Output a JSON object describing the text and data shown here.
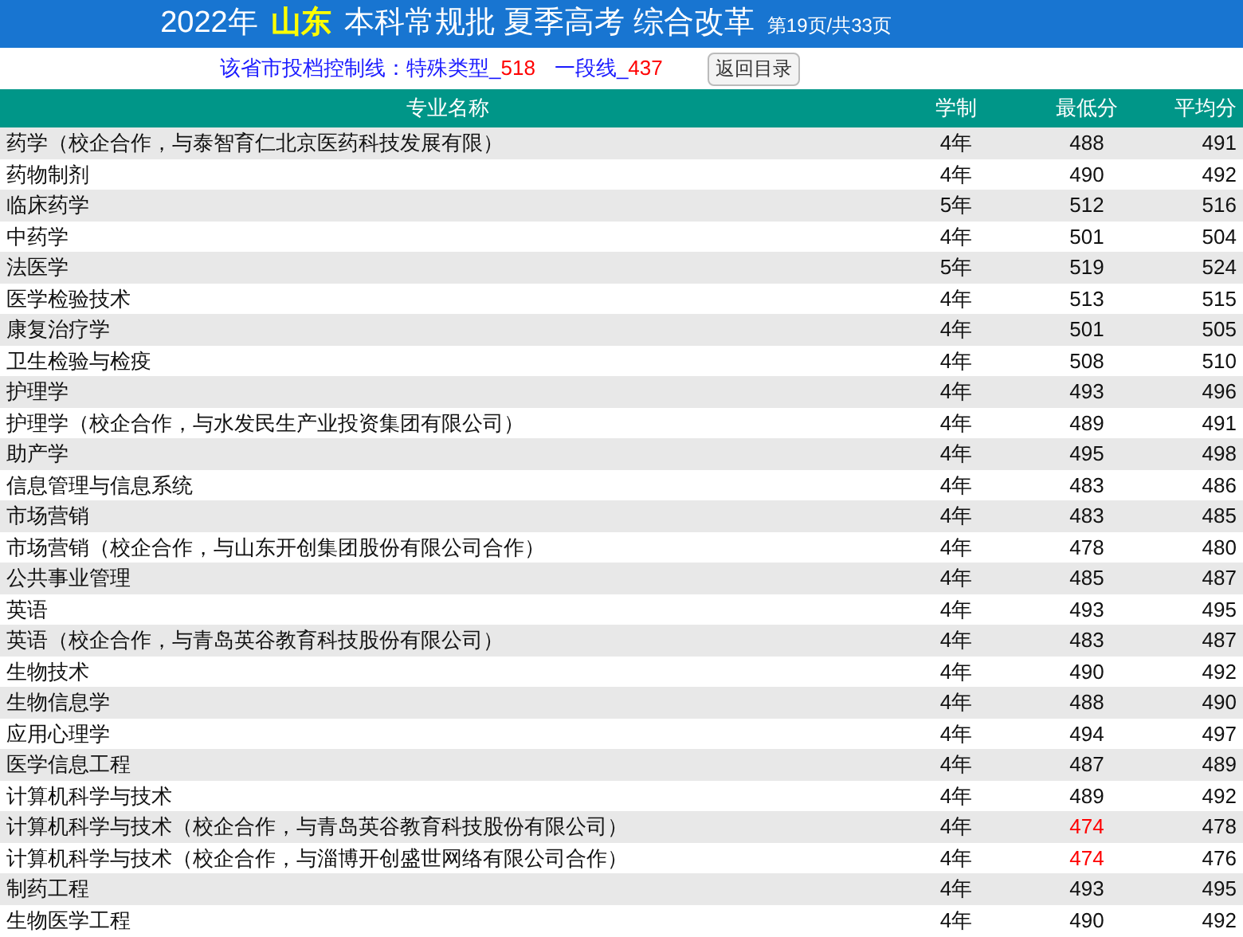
{
  "header": {
    "year": "2022年",
    "province": "山东",
    "title": "本科常规批 夏季高考 综合改革",
    "page": "第19页/共33页"
  },
  "control_line": {
    "label": "该省市投档控制线：特殊类型_",
    "special": "518",
    "first_label": "一段线_",
    "first": "437"
  },
  "back_button": "返回目录",
  "table": {
    "columns": [
      "专业名称",
      "学制",
      "最低分",
      "平均分"
    ],
    "rows": [
      {
        "name": "药学（校企合作，与泰智育仁北京医药科技发展有限）",
        "years": "4年",
        "min": "488",
        "avg": "491",
        "highlight": false
      },
      {
        "name": "药物制剂",
        "years": "4年",
        "min": "490",
        "avg": "492",
        "highlight": false
      },
      {
        "name": "临床药学",
        "years": "5年",
        "min": "512",
        "avg": "516",
        "highlight": false
      },
      {
        "name": "中药学",
        "years": "4年",
        "min": "501",
        "avg": "504",
        "highlight": false
      },
      {
        "name": "法医学",
        "years": "5年",
        "min": "519",
        "avg": "524",
        "highlight": false
      },
      {
        "name": "医学检验技术",
        "years": "4年",
        "min": "513",
        "avg": "515",
        "highlight": false
      },
      {
        "name": "康复治疗学",
        "years": "4年",
        "min": "501",
        "avg": "505",
        "highlight": false
      },
      {
        "name": "卫生检验与检疫",
        "years": "4年",
        "min": "508",
        "avg": "510",
        "highlight": false
      },
      {
        "name": "护理学",
        "years": "4年",
        "min": "493",
        "avg": "496",
        "highlight": false
      },
      {
        "name": "护理学（校企合作，与水发民生产业投资集团有限公司）",
        "years": "4年",
        "min": "489",
        "avg": "491",
        "highlight": false
      },
      {
        "name": "助产学",
        "years": "4年",
        "min": "495",
        "avg": "498",
        "highlight": false
      },
      {
        "name": "信息管理与信息系统",
        "years": "4年",
        "min": "483",
        "avg": "486",
        "highlight": false
      },
      {
        "name": "市场营销",
        "years": "4年",
        "min": "483",
        "avg": "485",
        "highlight": false
      },
      {
        "name": "市场营销（校企合作，与山东开创集团股份有限公司合作）",
        "years": "4年",
        "min": "478",
        "avg": "480",
        "highlight": false
      },
      {
        "name": "公共事业管理",
        "years": "4年",
        "min": "485",
        "avg": "487",
        "highlight": false
      },
      {
        "name": "英语",
        "years": "4年",
        "min": "493",
        "avg": "495",
        "highlight": false
      },
      {
        "name": "英语（校企合作，与青岛英谷教育科技股份有限公司）",
        "years": "4年",
        "min": "483",
        "avg": "487",
        "highlight": false
      },
      {
        "name": "生物技术",
        "years": "4年",
        "min": "490",
        "avg": "492",
        "highlight": false
      },
      {
        "name": "生物信息学",
        "years": "4年",
        "min": "488",
        "avg": "490",
        "highlight": false
      },
      {
        "name": "应用心理学",
        "years": "4年",
        "min": "494",
        "avg": "497",
        "highlight": false
      },
      {
        "name": "医学信息工程",
        "years": "4年",
        "min": "487",
        "avg": "489",
        "highlight": false
      },
      {
        "name": "计算机科学与技术",
        "years": "4年",
        "min": "489",
        "avg": "492",
        "highlight": false
      },
      {
        "name": "计算机科学与技术（校企合作，与青岛英谷教育科技股份有限公司）",
        "years": "4年",
        "min": "474",
        "avg": "478",
        "highlight": true
      },
      {
        "name": "计算机科学与技术（校企合作，与淄博开创盛世网络有限公司合作）",
        "years": "4年",
        "min": "474",
        "avg": "476",
        "highlight": true
      },
      {
        "name": "制药工程",
        "years": "4年",
        "min": "493",
        "avg": "495",
        "highlight": false
      },
      {
        "name": "生物医学工程",
        "years": "4年",
        "min": "490",
        "avg": "492",
        "highlight": false
      }
    ]
  }
}
